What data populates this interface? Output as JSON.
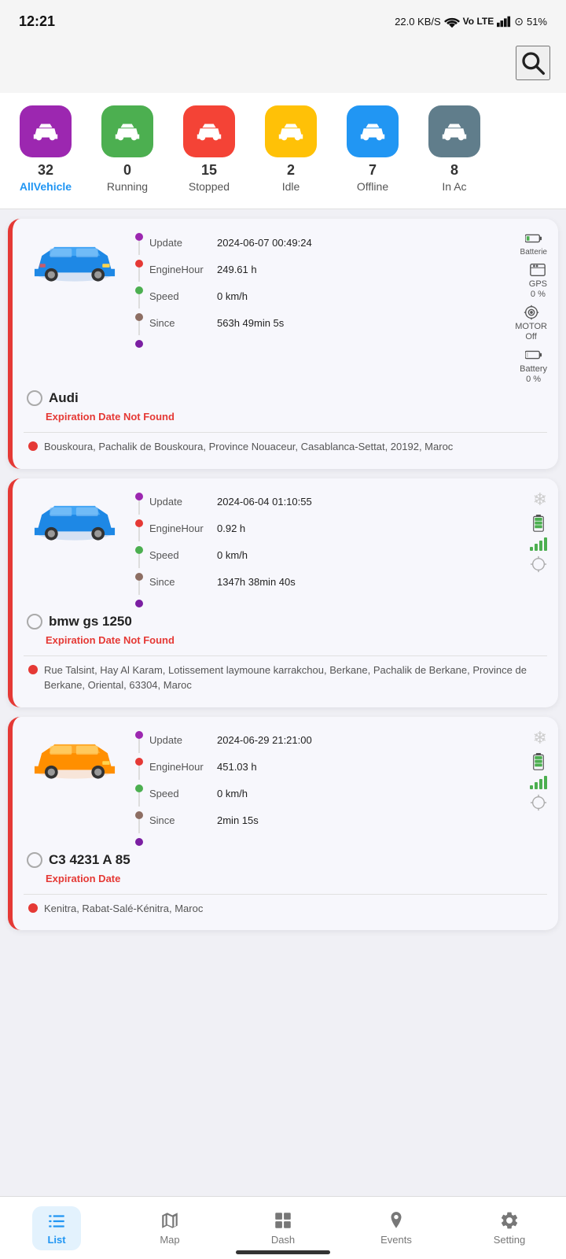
{
  "status_bar": {
    "time": "12:21",
    "network": "22.0 KB/S",
    "battery": "51%"
  },
  "categories": [
    {
      "id": "all",
      "count": "32",
      "label": "AllVehicle",
      "color": "cat-purple",
      "active": true
    },
    {
      "id": "running",
      "count": "0",
      "label": "Running",
      "color": "cat-green",
      "active": false
    },
    {
      "id": "stopped",
      "count": "15",
      "label": "Stopped",
      "color": "cat-red",
      "active": false
    },
    {
      "id": "idle",
      "count": "2",
      "label": "Idle",
      "color": "cat-yellow",
      "active": false
    },
    {
      "id": "offline",
      "count": "7",
      "label": "Offline",
      "color": "cat-blue",
      "active": false
    },
    {
      "id": "inac",
      "count": "8",
      "label": "In Ac",
      "color": "cat-dark",
      "active": false
    }
  ],
  "vehicles": [
    {
      "name": "Audi",
      "color": "blue",
      "update": "2024-06-07 00:49:24",
      "engine_hour": "249.61 h",
      "speed": "0 km/h",
      "since": "563h 49min 5s",
      "expiration": "Expiration Date Not Found",
      "address": "Bouskoura, Pachalik de Bouskoura, Province Nouaceur, Casablanca-Settat, 20192, Maroc",
      "batterie_label": "Batterie",
      "batterie_value": "GPS",
      "gps_value": "0 %",
      "motor_label": "MOTOR",
      "motor_value": "Off",
      "battery_label": "Battery",
      "battery_value": "0 %"
    },
    {
      "name": "bmw gs 1250",
      "color": "blue",
      "update": "2024-06-04 01:10:55",
      "engine_hour": "0.92 h",
      "speed": "0 km/h",
      "since": "1347h 38min 40s",
      "expiration": "Expiration Date Not Found",
      "address": "Rue Talsint, Hay Al Karam, Lotissement laymoune karrakchou, Berkane, Pachalik de Berkane, Province de Berkane, Oriental, 63304, Maroc",
      "show_snow": true,
      "show_battery_green": true,
      "show_signal": true,
      "show_crosshair": true
    },
    {
      "name": "C3 4231 A 85",
      "color": "yellow",
      "update": "2024-06-29 21:21:00",
      "engine_hour": "451.03 h",
      "speed": "0 km/h",
      "since": "2min 15s",
      "expiration": "Expiration Date",
      "address": "Kenitra, Rabat-Salé-Kénitra, Maroc",
      "show_snow": true,
      "show_battery_green": true,
      "show_signal": true,
      "show_crosshair": true
    }
  ],
  "nav": {
    "list": "List",
    "map": "Map",
    "dash": "Dash",
    "events": "Events",
    "setting": "Setting"
  }
}
